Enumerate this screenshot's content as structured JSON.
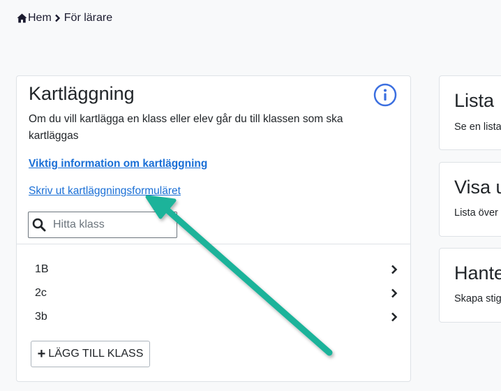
{
  "breadcrumb": {
    "home": "Hem",
    "current": "För lärare"
  },
  "main": {
    "title": "Kartläggning",
    "description": "Om du vill kartlägga en klass eller elev går du till klassen som ska kartläggas",
    "important_link": "Viktig information om kartläggning",
    "print_link": "Skriv ut kartläggningsformuläret",
    "search": {
      "placeholder": "Hitta klass",
      "value": ""
    },
    "classes": [
      "1B",
      "2c",
      "3b"
    ],
    "add_button": "LÄGG TILL KLASS"
  },
  "side_cards": [
    {
      "title": "Lista",
      "description": "Se en lista"
    },
    {
      "title": "Visa u",
      "description": "Lista över"
    },
    {
      "title": "Hante",
      "description": "Skapa stig"
    }
  ],
  "colors": {
    "link": "#1a6fd6",
    "info_icon": "#3b6fe0",
    "annotation_arrow": "#1fb39a"
  }
}
